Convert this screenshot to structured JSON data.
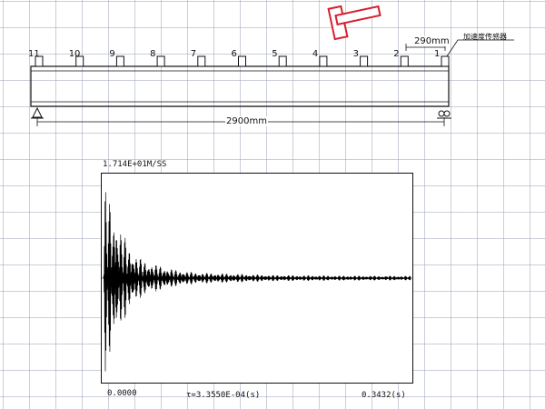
{
  "diagram": {
    "sensor_label": "加速度传感器",
    "spacing_label": "290mm",
    "span_label": "2900mm",
    "positions": [
      "11",
      "10",
      "9",
      "8",
      "7",
      "6",
      "5",
      "4",
      "3",
      "2",
      "1"
    ]
  },
  "chart_data": {
    "type": "line",
    "title": "",
    "ylabel": "1.714E+01M/SS",
    "x_start_label": "0.0000",
    "x_step_label": "τ=3.3550E-04(s)",
    "x_end_label": "0.3432(s)",
    "xlim": [
      0,
      0.3432
    ],
    "ylim": [
      -17.14,
      17.14
    ],
    "series": [
      {
        "name": "",
        "color": "#000000",
        "description_values_note": "",
        "x": [
          0,
          0.002,
          0.004,
          0.006,
          0.008,
          0.01,
          0.012,
          0.014,
          0.016,
          0.018,
          0.02,
          0.022,
          0.024,
          0.026,
          0.028,
          0.03,
          0.032,
          0.034,
          0.036,
          0.038,
          0.04,
          0.045,
          0.05,
          0.055,
          0.06,
          0.065,
          0.07,
          0.075,
          0.08,
          0.085,
          0.09,
          0.095,
          0.1,
          0.11,
          0.12,
          0.13,
          0.14,
          0.15,
          0.16,
          0.17,
          0.18,
          0.19,
          0.2,
          0.22,
          0.24,
          0.26,
          0.28,
          0.3,
          0.32,
          0.3432
        ],
        "y": [
          0,
          16.5,
          -15.8,
          12.0,
          -14.2,
          10.5,
          -11.0,
          12.2,
          -9.0,
          8.5,
          -8.0,
          7.2,
          -6.8,
          6.0,
          -5.6,
          5.2,
          -4.8,
          4.4,
          -4.0,
          3.7,
          -3.4,
          3.0,
          -2.7,
          2.4,
          -2.2,
          2.0,
          -1.8,
          1.6,
          -1.4,
          1.3,
          -1.2,
          1.1,
          -1.0,
          0.9,
          -0.85,
          0.8,
          -0.75,
          0.7,
          -0.65,
          0.6,
          -0.55,
          0.5,
          -0.5,
          0.45,
          -0.45,
          0.4,
          -0.4,
          0.38,
          -0.38,
          0.36
        ]
      }
    ],
    "grid": false
  }
}
